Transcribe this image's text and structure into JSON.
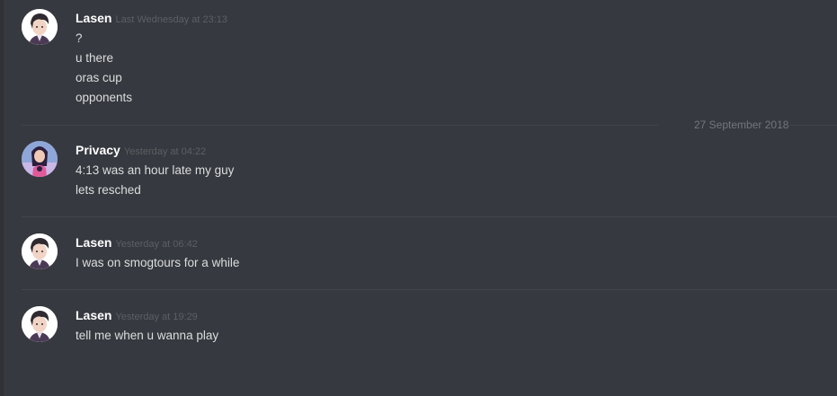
{
  "date_divider": "27 September 2018",
  "messages": [
    {
      "username": "Lasen",
      "timestamp": "Last Wednesday at 23:13",
      "lines": [
        "?",
        "u there",
        "oras cup",
        "opponents"
      ]
    },
    {
      "username": "Privacy",
      "timestamp": "Yesterday at 04:22",
      "lines": [
        "4:13 was an hour late my guy",
        "lets resched"
      ]
    },
    {
      "username": "Lasen",
      "timestamp": "Yesterday at 06:42",
      "lines": [
        "I was on smogtours for a while"
      ]
    },
    {
      "username": "Lasen",
      "timestamp": "Yesterday at 19:29",
      "lines": [
        "tell me when u wanna play"
      ]
    }
  ],
  "colors": {
    "background": "#36393f",
    "username": "#ffffff",
    "message_text": "#dcddde",
    "timestamp": "#5c5f63",
    "divider": "#42454a"
  }
}
